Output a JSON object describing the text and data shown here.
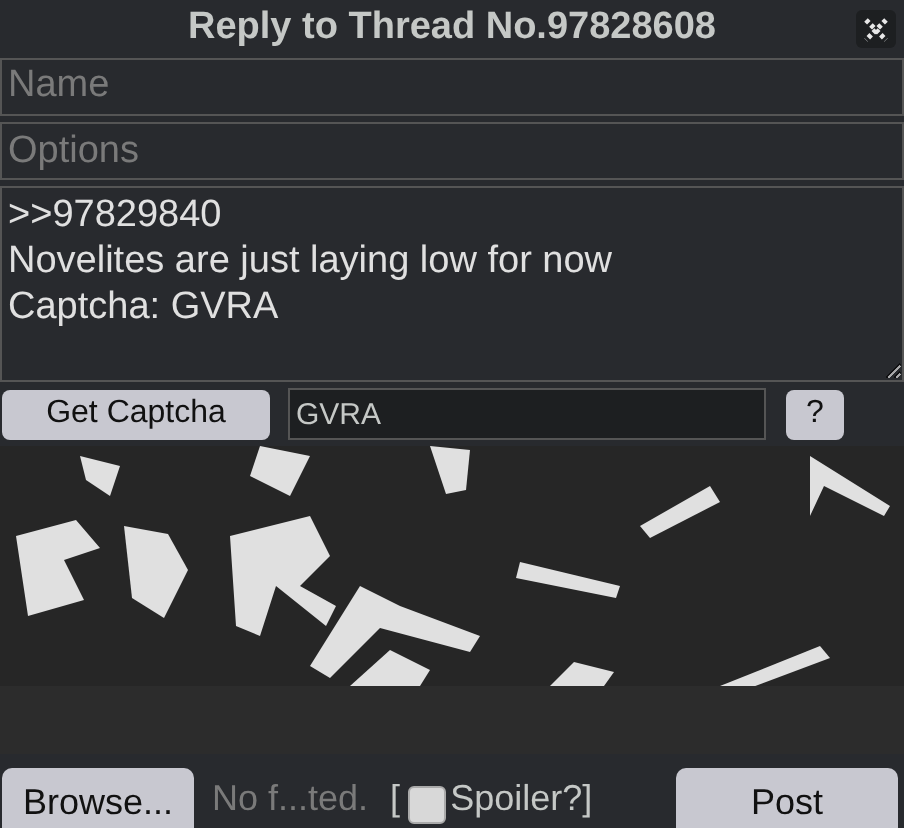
{
  "window": {
    "title": "Reply to Thread No.97828608"
  },
  "fields": [
    {
      "placeholder": "Name"
    },
    {
      "placeholder": "Options"
    }
  ],
  "comment": {
    "value": ">>97829840\nNovelites are just laying low for now\nCaptcha: GVRA"
  },
  "captcha": {
    "button": "Get Captcha",
    "value": "GVRA",
    "help": "?"
  },
  "footer": {
    "browse": "Browse...",
    "file_status": "No f...ted.",
    "bracket_open": "[",
    "spoiler": {
      "label": "Spoiler?]",
      "checked": false
    },
    "post": "Post"
  }
}
